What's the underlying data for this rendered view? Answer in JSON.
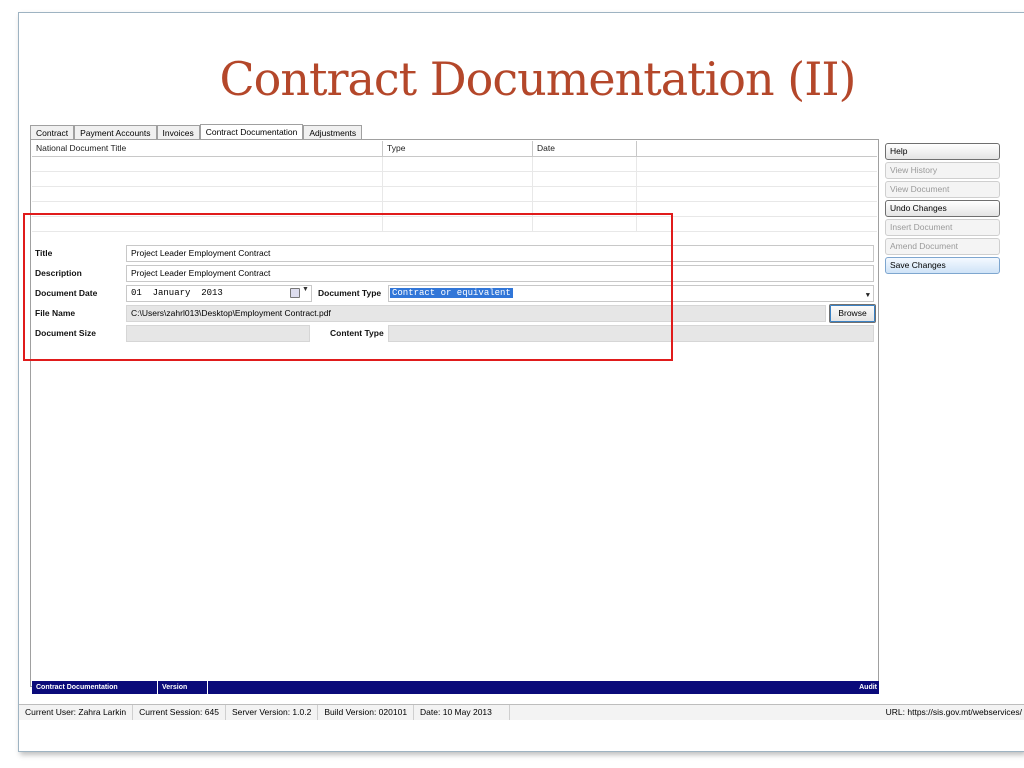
{
  "slide": {
    "title": "Contract Documentation (II)"
  },
  "tabs": [
    {
      "label": "Contract",
      "active": false
    },
    {
      "label": "Payment Accounts",
      "active": false
    },
    {
      "label": "Invoices",
      "active": false
    },
    {
      "label": "Contract Documentation",
      "active": true
    },
    {
      "label": "Adjustments",
      "active": false
    }
  ],
  "grid": {
    "columns": [
      "National Document Title",
      "Type",
      "Date",
      ""
    ],
    "rows": [
      [],
      [],
      [],
      [],
      []
    ]
  },
  "form": {
    "title_label": "Title",
    "title_value": "Project Leader Employment Contract",
    "description_label": "Description",
    "description_value": "Project Leader Employment Contract",
    "document_date_label": "Document Date",
    "document_date_value": "01  January  2013",
    "document_type_label": "Document Type",
    "document_type_value": "Contract or equivalent",
    "file_name_label": "File Name",
    "file_name_value": "C:\\Users\\zahrl013\\Desktop\\Employment Contract.pdf",
    "browse_label": "Browse",
    "document_size_label": "Document Size",
    "document_size_value": "",
    "content_type_label": "Content Type",
    "content_type_value": ""
  },
  "panel_footer": {
    "section": "Contract Documentation",
    "version": "Version",
    "audit": "Audit"
  },
  "side_buttons": [
    {
      "label": "Help",
      "enabled": true
    },
    {
      "label": "View History",
      "enabled": false
    },
    {
      "label": "View Document",
      "enabled": false
    },
    {
      "label": "Undo Changes",
      "enabled": true
    },
    {
      "label": "Insert Document",
      "enabled": false
    },
    {
      "label": "Amend Document",
      "enabled": false
    },
    {
      "label": "Save Changes",
      "enabled": true
    }
  ],
  "statusbar": {
    "user": "Current User: Zahra Larkin",
    "session": "Current Session: 645",
    "server": "Server Version: 1.0.2",
    "build": "Build Version: 020101",
    "date": "Date: 10 May 2013",
    "url": "URL: https://sis.gov.mt/webservices/"
  },
  "colors": {
    "title": "#b4472a",
    "footer_bar": "#0a0a7a",
    "highlight_box": "#e01b1b",
    "selection": "#3176d8"
  },
  "icons": [
    "calendar-icon",
    "chevron-down-icon"
  ]
}
